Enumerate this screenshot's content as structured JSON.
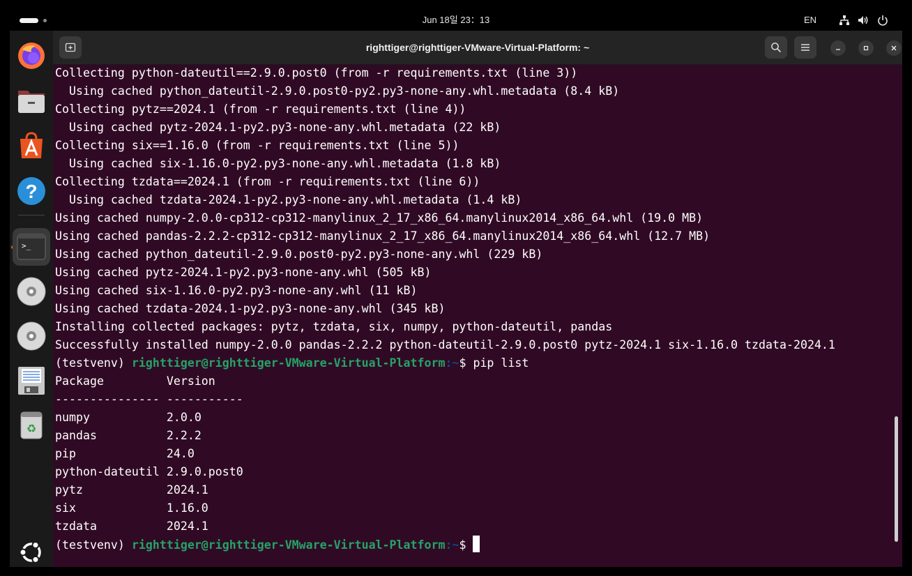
{
  "topbar": {
    "clock": "Jun 18일 23：13",
    "language": "EN"
  },
  "dock": {
    "items": [
      {
        "name": "firefox-icon"
      },
      {
        "name": "files-icon"
      },
      {
        "name": "app-center-icon"
      },
      {
        "name": "help-icon"
      },
      {
        "name": "terminal-icon",
        "active": true
      },
      {
        "name": "disc-icon"
      },
      {
        "name": "disc-icon"
      },
      {
        "name": "floppy-save-icon"
      },
      {
        "name": "trash-icon"
      }
    ],
    "show_apps": "ubuntu-logo-icon"
  },
  "window": {
    "title": "righttiger@righttiger-VMware-Virtual-Platform: ~"
  },
  "terminal": {
    "lines": [
      "Collecting python-dateutil==2.9.0.post0 (from -r requirements.txt (line 3))",
      "  Using cached python_dateutil-2.9.0.post0-py2.py3-none-any.whl.metadata (8.4 kB)",
      "Collecting pytz==2024.1 (from -r requirements.txt (line 4))",
      "  Using cached pytz-2024.1-py2.py3-none-any.whl.metadata (22 kB)",
      "Collecting six==1.16.0 (from -r requirements.txt (line 5))",
      "  Using cached six-1.16.0-py2.py3-none-any.whl.metadata (1.8 kB)",
      "Collecting tzdata==2024.1 (from -r requirements.txt (line 6))",
      "  Using cached tzdata-2024.1-py2.py3-none-any.whl.metadata (1.4 kB)",
      "Using cached numpy-2.0.0-cp312-cp312-manylinux_2_17_x86_64.manylinux2014_x86_64.whl (19.0 MB)",
      "Using cached pandas-2.2.2-cp312-cp312-manylinux_2_17_x86_64.manylinux2014_x86_64.whl (12.7 MB)",
      "Using cached python_dateutil-2.9.0.post0-py2.py3-none-any.whl (229 kB)",
      "Using cached pytz-2024.1-py2.py3-none-any.whl (505 kB)",
      "Using cached six-1.16.0-py2.py3-none-any.whl (11 kB)",
      "Using cached tzdata-2024.1-py2.py3-none-any.whl (345 kB)",
      "Installing collected packages: pytz, tzdata, six, numpy, python-dateutil, pandas",
      "Successfully installed numpy-2.0.0 pandas-2.2.2 python-dateutil-2.9.0.post0 pytz-2024.1 six-1.16.0 tzdata-2024.1"
    ],
    "prompt_env": "(testvenv) ",
    "prompt_user": "righttiger@righttiger-VMware-Virtual-Platform",
    "prompt_path": ":~",
    "prompt_symbol": "$ ",
    "command": "pip list",
    "pip_list_header": [
      "Package",
      "Version"
    ],
    "pip_list_sep": [
      "---------------",
      "-----------"
    ],
    "packages": [
      {
        "name": "numpy",
        "version": "2.0.0"
      },
      {
        "name": "pandas",
        "version": "2.2.2"
      },
      {
        "name": "pip",
        "version": "24.0"
      },
      {
        "name": "python-dateutil",
        "version": "2.9.0.post0"
      },
      {
        "name": "pytz",
        "version": "2024.1"
      },
      {
        "name": "six",
        "version": "1.16.0"
      },
      {
        "name": "tzdata",
        "version": "2024.1"
      }
    ]
  },
  "colors": {
    "terminal_bg": "#300a24",
    "prompt_user": "#26a269",
    "prompt_path": "#12488b",
    "accent": "#e95420"
  }
}
